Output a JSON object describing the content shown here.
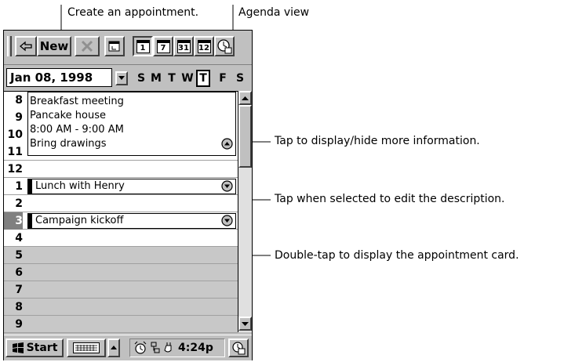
{
  "callouts": {
    "create_appointment": "Create an appointment.",
    "agenda_view": "Agenda view",
    "more_info": "Tap to display/hide more information.",
    "edit_description": "Tap when selected to edit the description.",
    "appointment_card": "Double-tap to display the appointment card."
  },
  "toolbar": {
    "new_label": "New",
    "view_buttons": [
      "1",
      "7",
      "31",
      "12"
    ],
    "selected_view": "1"
  },
  "date_bar": {
    "date": "Jan 08, 1998",
    "weekdays": [
      "S",
      "M",
      "T",
      "W",
      "T",
      "F",
      "S"
    ],
    "selected_weekday_index": 4
  },
  "schedule": {
    "hours": [
      "8",
      "9",
      "10",
      "11",
      "12",
      "1",
      "2",
      "3",
      "4",
      "5",
      "6",
      "7",
      "8",
      "9"
    ],
    "current_hour_index": 7,
    "expanded_appointment": {
      "title": "Breakfast meeting",
      "location": "Pancake house",
      "time": "8:00 AM - 9:00 AM",
      "notes": "Bring drawings"
    },
    "appointments": [
      {
        "title": "Lunch with Henry",
        "hour": "1"
      },
      {
        "title": "Campaign kickoff",
        "hour": "3"
      }
    ]
  },
  "taskbar": {
    "start_label": "Start",
    "clock": "4:24p"
  },
  "colors": {
    "chrome": "#c0c0c0",
    "current_hour_bg": "#808080",
    "free_hour_bg": "#c8c8c8"
  }
}
